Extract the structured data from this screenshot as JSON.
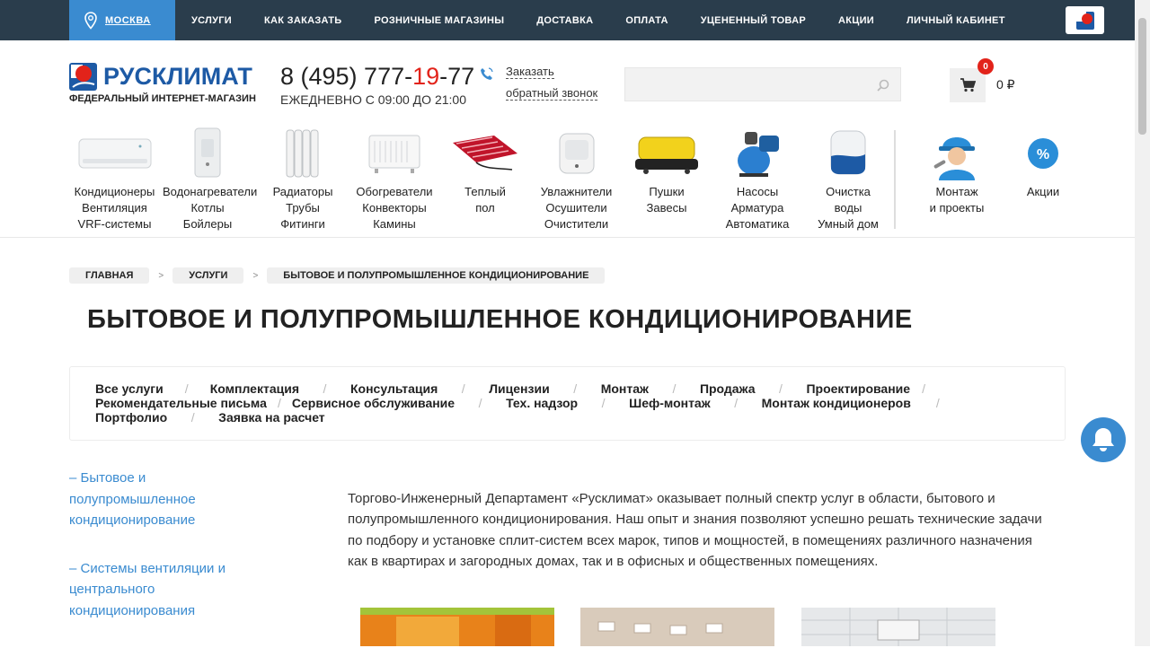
{
  "topbar": {
    "city": "МОСКВА",
    "nav": [
      "УСЛУГИ",
      "КАК ЗАКАЗАТЬ",
      "РОЗНИЧНЫЕ МАГАЗИНЫ",
      "ДОСТАВКА",
      "ОПЛАТА",
      "УЦЕНЕННЫЙ ТОВАР",
      "АКЦИИ",
      "ЛИЧНЫЙ КАБИНЕТ"
    ]
  },
  "header": {
    "brand": "РУСКЛИМАТ",
    "tagline": "ФЕДЕРАЛЬНЫЙ ИНТЕРНЕТ-МАГАЗИН",
    "phone_a": "8 (495) 777-",
    "phone_red": "19",
    "phone_b": "-77",
    "hours": "ЕЖЕДНЕВНО С 09:00 ДО 21:00",
    "callback_line1": "Заказать",
    "callback_line2": "обратный звонок",
    "search_placeholder": "",
    "cart_count": "0",
    "cart_sum": "0 ₽"
  },
  "categories": [
    {
      "icon": "air-conditioner-icon",
      "lines": [
        "Кондиционеры",
        "Вентиляция",
        "VRF-системы"
      ]
    },
    {
      "icon": "water-heater-icon",
      "lines": [
        "Водонагреватели",
        "Котлы",
        "Бойлеры"
      ]
    },
    {
      "icon": "radiator-icon",
      "lines": [
        "Радиаторы",
        "Трубы",
        "Фитинги"
      ]
    },
    {
      "icon": "convector-heater-icon",
      "lines": [
        "Обогреватели",
        "Конвекторы",
        "Камины"
      ]
    },
    {
      "icon": "floor-heating-icon",
      "lines": [
        "Теплый",
        "пол"
      ]
    },
    {
      "icon": "humidifier-icon",
      "lines": [
        "Увлажнители",
        "Осушители",
        "Очистители"
      ]
    },
    {
      "icon": "heat-gun-icon",
      "lines": [
        "Пушки",
        "Завесы"
      ]
    },
    {
      "icon": "water-pump-icon",
      "lines": [
        "Насосы",
        "Арматура",
        "Автоматика"
      ]
    },
    {
      "icon": "water-filter-icon",
      "lines": [
        "Очистка",
        "воды",
        "Умный дом"
      ]
    },
    {
      "icon": "installer-icon",
      "lines": [
        "Монтаж",
        "и проекты"
      ]
    },
    {
      "icon": "discount-icon",
      "lines": [
        "Акции"
      ]
    }
  ],
  "breadcrumbs": [
    "ГЛАВНАЯ",
    "УСЛУГИ",
    "БЫТОВОЕ И ПОЛУПРОМЫШЛЕННОЕ КОНДИЦИОНИРОВАНИЕ"
  ],
  "breadcrumb_sep": ">",
  "page_title": "БЫТОВОЕ И ПОЛУПРОМЫШЛЕННОЕ КОНДИЦИОНИРОВАНИЕ",
  "tab_sep": "/",
  "tabs_rows": [
    [
      "Все услуги",
      "Комплектация",
      "Консультация",
      "Лицензии",
      "Монтаж",
      "Продажа",
      "Проектирование"
    ],
    [
      "Рекомендательные письма",
      "Сервисное обслуживание",
      "Тех. надзор",
      "Шеф-монтаж",
      "Монтаж кондиционеров"
    ],
    [
      "Портфолио",
      "Заявка на расчет"
    ]
  ],
  "sidebar": [
    [
      "– Бытовое и",
      "полупромышленное",
      "кондиционирование"
    ],
    [
      "– Системы вентиляции и",
      "центрального",
      "кондиционирования"
    ]
  ],
  "intro_lines": [
    "Торгово-Инженерный Департамент «Русклимат» оказывает полный спектр услуг в области, бытового и",
    "полупромышленного кондиционирования. Наш опыт и знания позволяют успешно решать технические задачи",
    "по подбору и установке сплит-систем всех марок, типов и мощностей, в помещениях различного назначения",
    "как в квартирах и загородных домах, так и в офисных и общественных помещениях."
  ],
  "colors": {
    "topbar": "#2a3d4c",
    "accent": "#3a8bd0",
    "brand": "#1d5aa5",
    "red": "#e2231a"
  }
}
